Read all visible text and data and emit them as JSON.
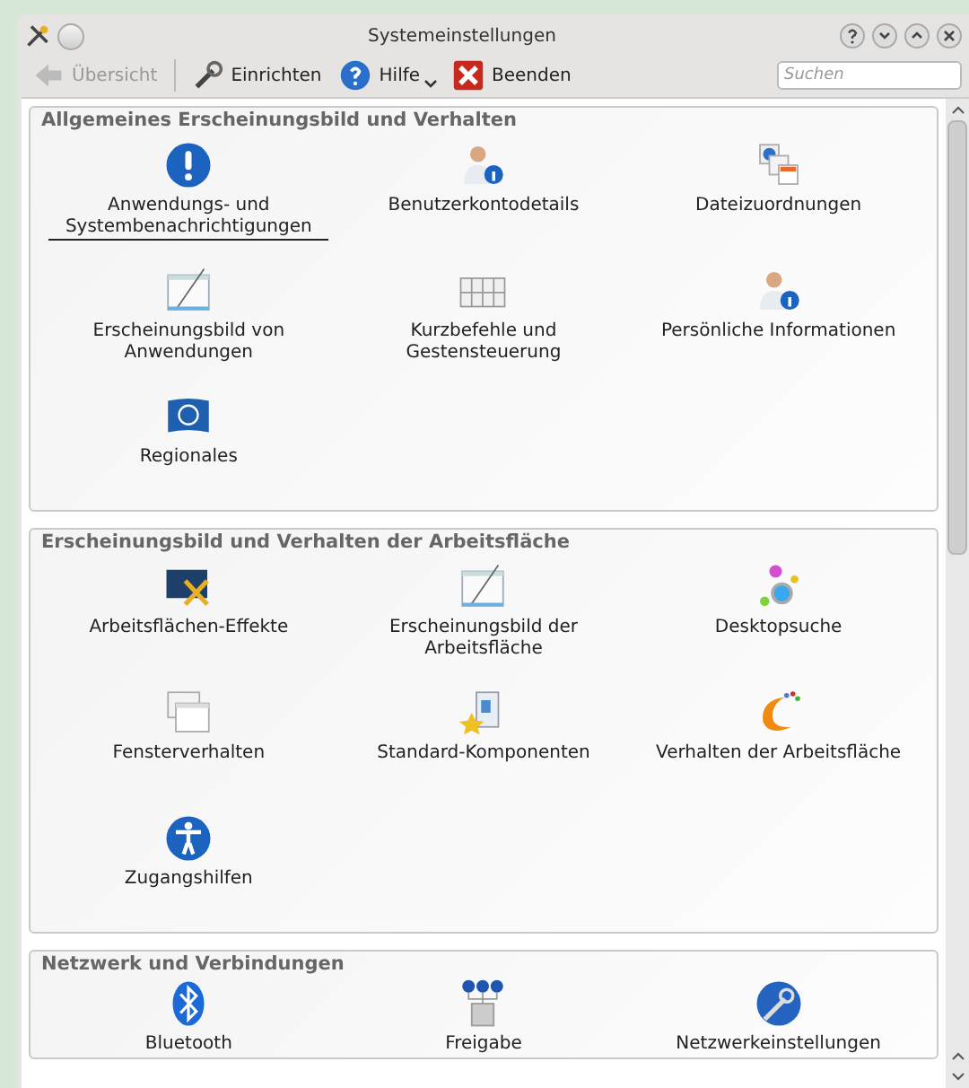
{
  "window": {
    "title": "Systemeinstellungen"
  },
  "toolbar": {
    "items": [
      {
        "label": "Übersicht",
        "disabled": true
      },
      {
        "label": "Einrichten",
        "disabled": false
      },
      {
        "label": "Hilfe",
        "disabled": false
      },
      {
        "label": "Beenden",
        "disabled": false
      }
    ],
    "search": {
      "placeholder": "Suchen"
    }
  },
  "sections": [
    {
      "title": "Allgemeines Erscheinungsbild und Verhalten",
      "items": [
        {
          "label": "Anwendungs- und Systembenachrichtigungen",
          "selected": true
        },
        {
          "label": "Benutzerkontodetails",
          "selected": false
        },
        {
          "label": "Dateizuordnungen",
          "selected": false
        },
        {
          "label": "Erscheinungsbild von Anwendungen",
          "selected": false
        },
        {
          "label": "Kurzbefehle und Gestensteuerung",
          "selected": false
        },
        {
          "label": "Persönliche Informationen",
          "selected": false
        },
        {
          "label": "Regionales",
          "selected": false
        }
      ]
    },
    {
      "title": "Erscheinungsbild und Verhalten der Arbeitsfläche",
      "items": [
        {
          "label": "Arbeitsflächen-Effekte",
          "selected": false
        },
        {
          "label": "Erscheinungsbild der Arbeitsfläche",
          "selected": false
        },
        {
          "label": "Desktopsuche",
          "selected": false
        },
        {
          "label": "Fensterverhalten",
          "selected": false
        },
        {
          "label": "Standard-Komponenten",
          "selected": false
        },
        {
          "label": "Verhalten der Arbeitsfläche",
          "selected": false
        },
        {
          "label": "Zugangshilfen",
          "selected": false
        }
      ]
    },
    {
      "title": "Netzwerk und Verbindungen",
      "items": [
        {
          "label": "Bluetooth",
          "selected": false
        },
        {
          "label": "Freigabe",
          "selected": false
        },
        {
          "label": "Netzwerkeinstellungen",
          "selected": false
        }
      ]
    }
  ]
}
